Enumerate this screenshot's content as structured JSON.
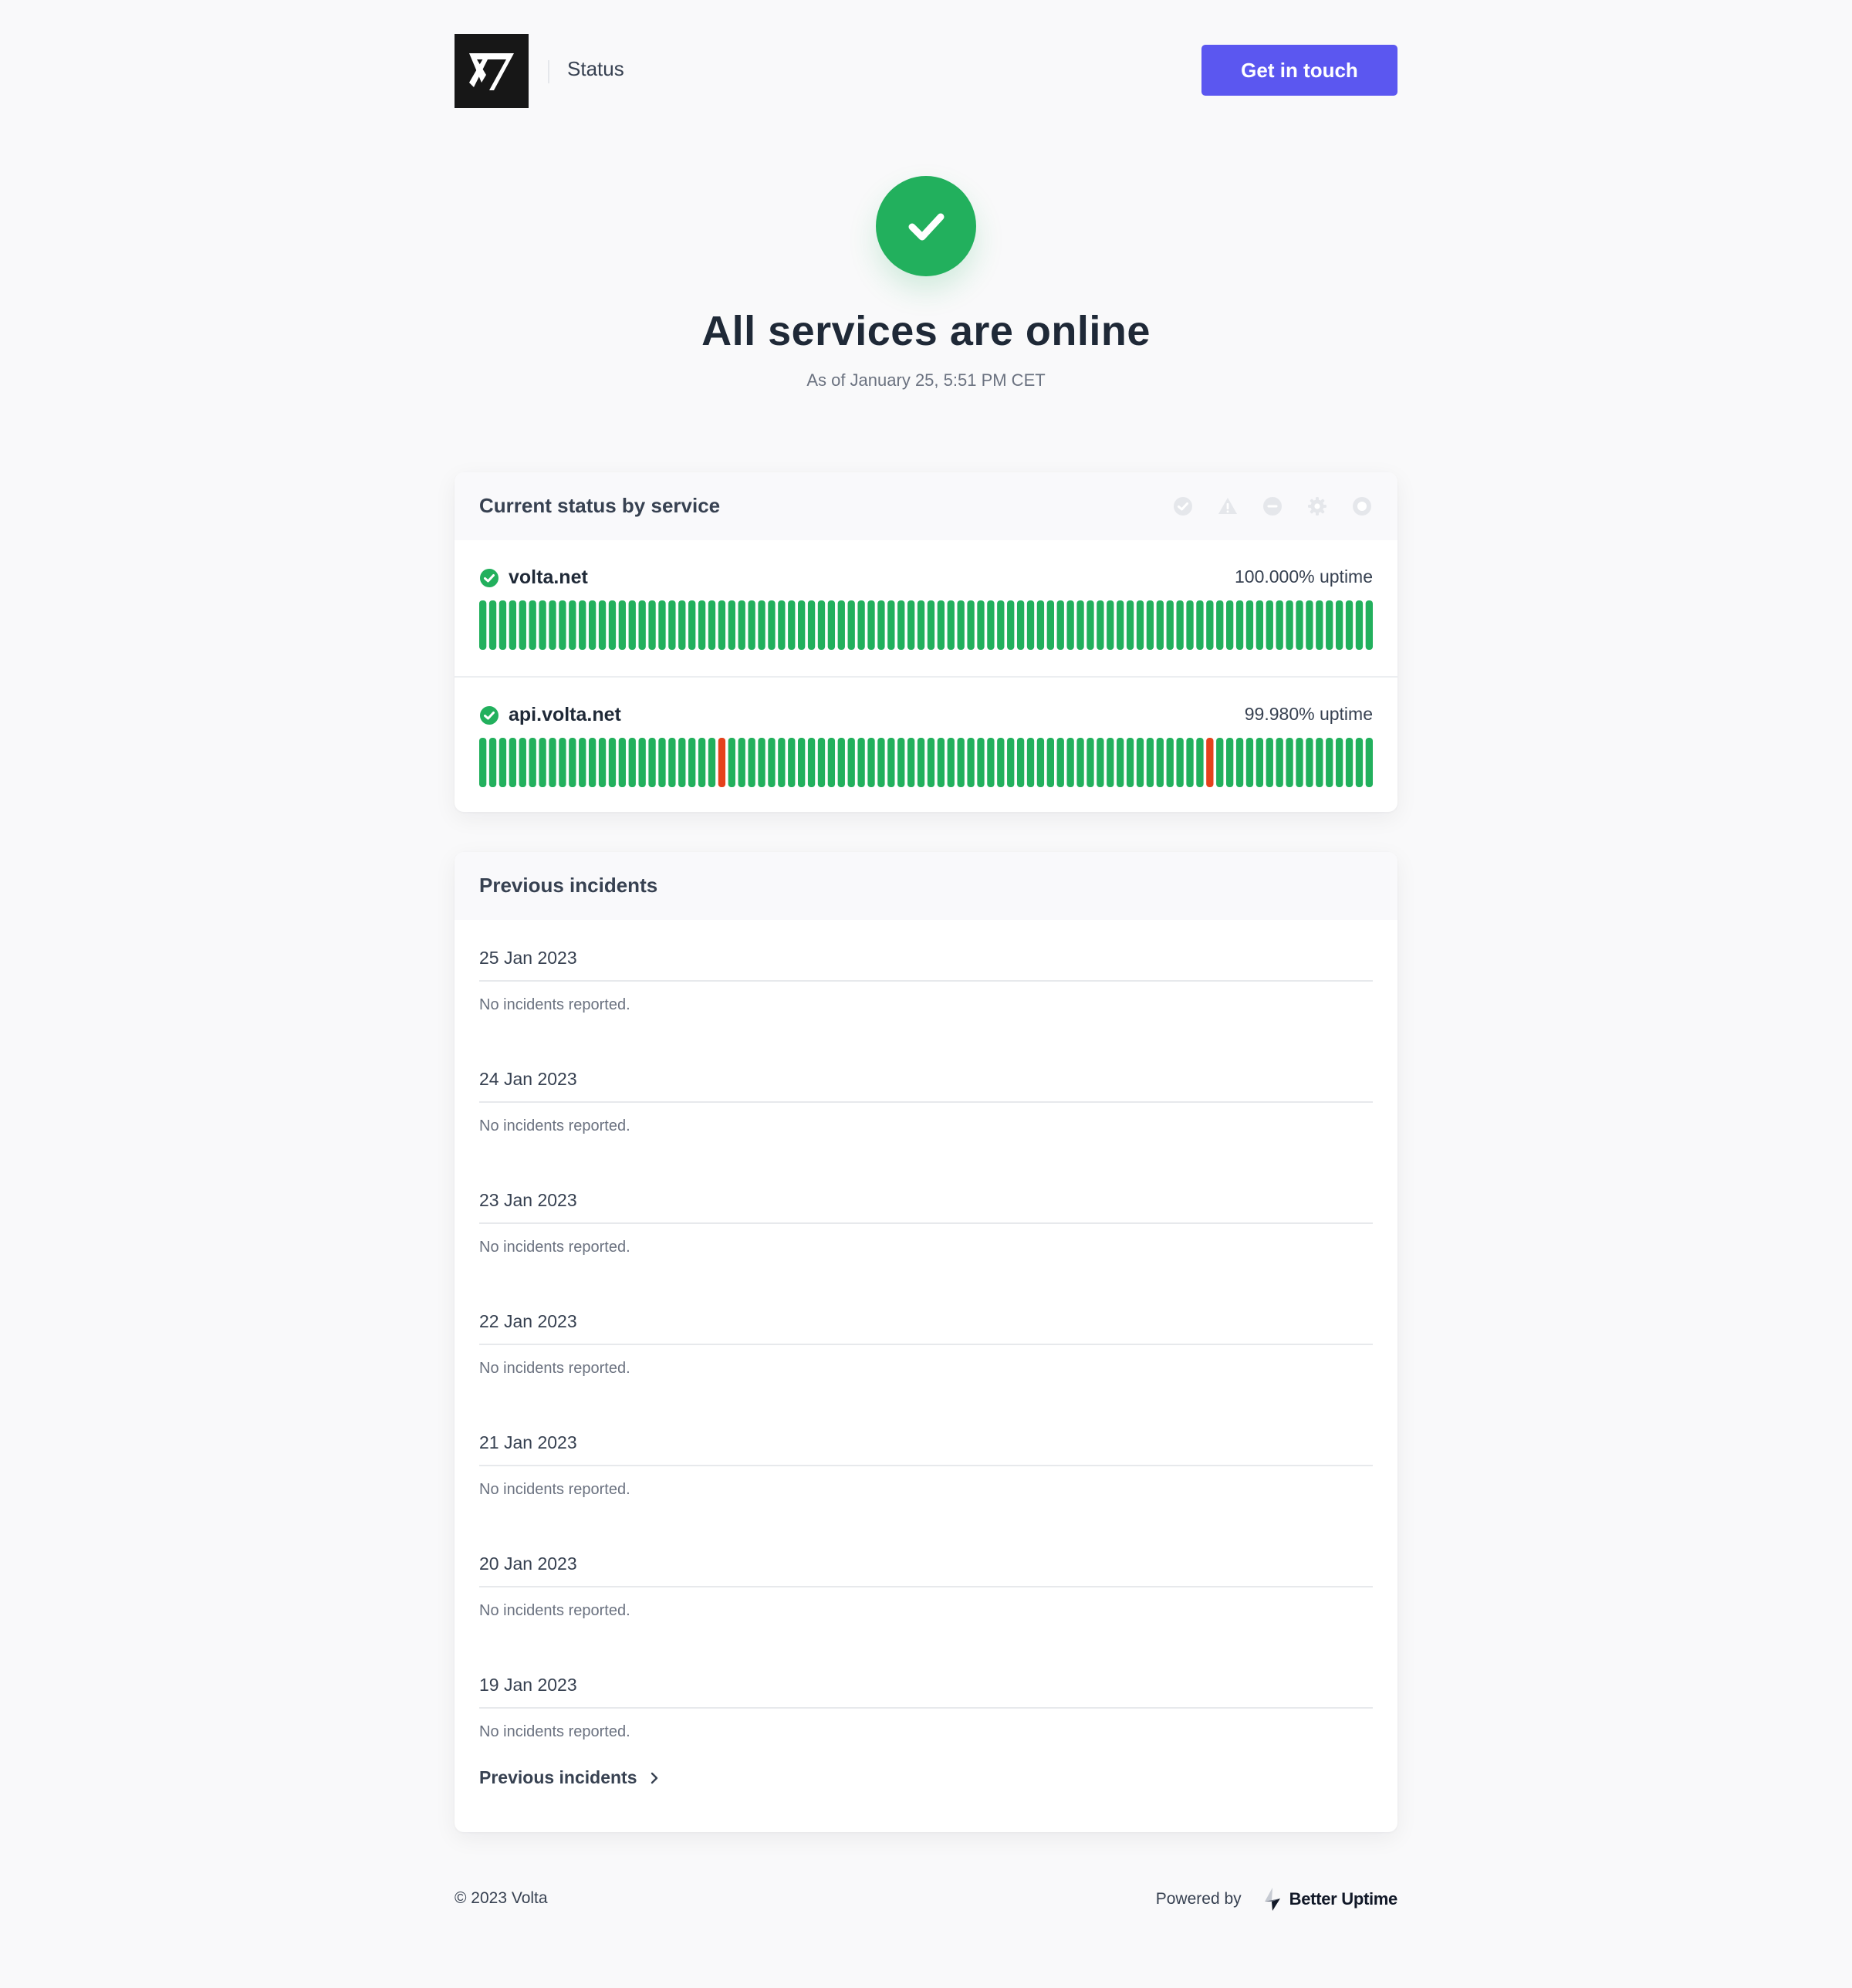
{
  "header": {
    "title": "Status",
    "cta_label": "Get in touch"
  },
  "hero": {
    "title": "All services are online",
    "subtitle": "As of January 25, 5:51 PM CET"
  },
  "status_card": {
    "title": "Current status by service",
    "legend_icons": [
      "operational-icon",
      "degraded-icon",
      "downtime-icon",
      "maintenance-icon",
      "not-monitored-icon"
    ],
    "services": [
      {
        "name": "volta.net",
        "uptime": "100.000% uptime",
        "day_count": 90,
        "incident_days": []
      },
      {
        "name": "api.volta.net",
        "uptime": "99.980% uptime",
        "day_count": 90,
        "incident_days": [
          24,
          73
        ]
      }
    ],
    "colors": {
      "up": "#22b05d",
      "down": "#e5411c"
    }
  },
  "incidents_card": {
    "title": "Previous incidents",
    "days": [
      {
        "date": "25 Jan 2023",
        "note": "No incidents reported."
      },
      {
        "date": "24 Jan 2023",
        "note": "No incidents reported."
      },
      {
        "date": "23 Jan 2023",
        "note": "No incidents reported."
      },
      {
        "date": "22 Jan 2023",
        "note": "No incidents reported."
      },
      {
        "date": "21 Jan 2023",
        "note": "No incidents reported."
      },
      {
        "date": "20 Jan 2023",
        "note": "No incidents reported."
      },
      {
        "date": "19 Jan 2023",
        "note": "No incidents reported."
      }
    ],
    "more_link": "Previous incidents"
  },
  "footer": {
    "copyright": "© 2023 Volta",
    "powered_by": "Powered by",
    "brand": "Better Uptime"
  },
  "colors": {
    "accent": "#5b57f0",
    "success": "#22b05d",
    "danger": "#e5411c"
  }
}
